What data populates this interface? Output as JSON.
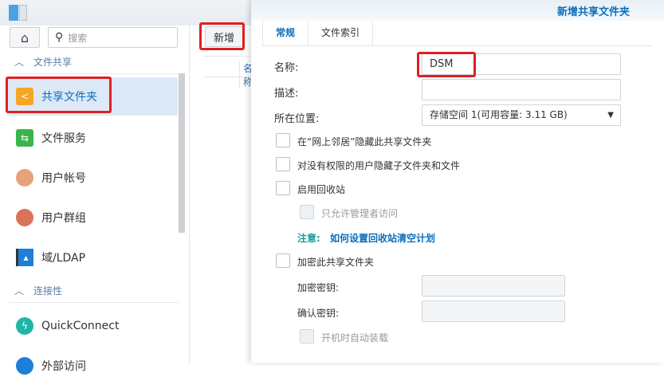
{
  "sidebar": {
    "search_placeholder": "搜索",
    "section1": "文件共享",
    "items": [
      {
        "label": "共享文件夹"
      },
      {
        "label": "文件服务"
      },
      {
        "label": "用户帐号"
      },
      {
        "label": "用户群组"
      },
      {
        "label": "域/LDAP"
      }
    ],
    "section2": "连接性",
    "items2": [
      {
        "label": "QuickConnect"
      },
      {
        "label": "外部访问"
      }
    ]
  },
  "toolbar": {
    "add_label": "新增",
    "col_name": "名称"
  },
  "dialog": {
    "title": "新增共享文件夹",
    "tabs": [
      "常规",
      "文件索引"
    ],
    "name_label": "名称:",
    "name_value": "DSM",
    "desc_label": "描述:",
    "loc_label": "所在位置:",
    "loc_value": "存储空间 1(可用容量:  3.11 GB)",
    "checks": [
      "在“网上邻居”隐藏此共享文件夹",
      "对没有权限的用户隐藏子文件夹和文件",
      "启用回收站",
      "只允许管理者访问"
    ],
    "note_label": "注意:",
    "note_link": "如何设置回收站清空计划",
    "encrypt_label": "加密此共享文件夹",
    "key_label": "加密密钥:",
    "confirm_label": "确认密钥:",
    "automount_label": "开机时自动装载"
  }
}
